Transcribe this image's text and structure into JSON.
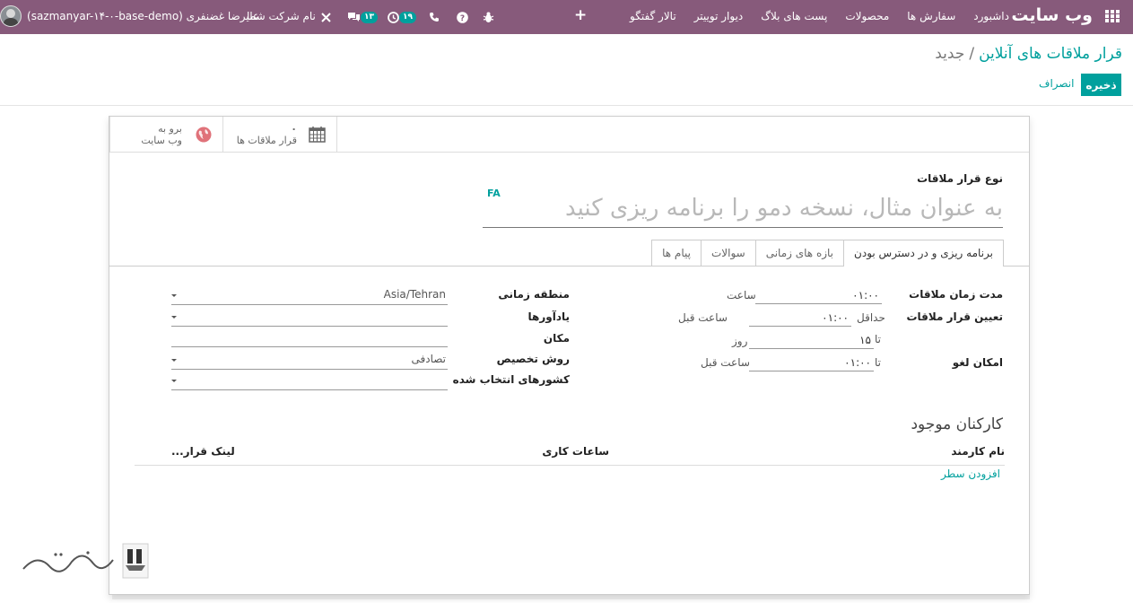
{
  "navbar": {
    "brand": "وب سایت",
    "menu": [
      "داشبورد",
      "سفارش ها",
      "محصولات",
      "پست های بلاگ",
      "دیوار توییتر",
      "تالار گفتگو"
    ],
    "plus": "+",
    "activity_count": "۱۹",
    "messages_count": "۱۳",
    "company": "نام شرکت شما",
    "user_name": "علیرضا غضنفری (sazmanyar-۱۴-۰-base-demo)"
  },
  "breadcrumb": {
    "parent": "قرار ملاقات های آنلاین",
    "separator": "/",
    "current": "جدید"
  },
  "buttons": {
    "save": "ذخیره",
    "discard": "انصراف"
  },
  "smart_buttons": {
    "appointments_count": "۰",
    "appointments_label": "قرار ملاقات ها",
    "website_line1": "برو به",
    "website_line2": "وب سایت"
  },
  "form": {
    "name_label": "نوع قرار ملاقات",
    "name_placeholder": "به عنوان مثال، نسخه دمو را برنامه ریزی کنید",
    "lang_tag": "FA"
  },
  "tabs": [
    {
      "label": "برنامه ریزی و در دسترس بودن",
      "active": true
    },
    {
      "label": "بازه های زمانی",
      "active": false
    },
    {
      "label": "سوالات",
      "active": false
    },
    {
      "label": "پیام ها",
      "active": false
    }
  ],
  "left_group": {
    "duration_label": "مدت زمان ملاقات",
    "duration_value": "۰۱:۰۰",
    "duration_unit": "ساعت",
    "scheduling_label": "تعیین قرار ملاقات",
    "min_prefix": "حداقل",
    "min_value": "۰۱:۰۰",
    "min_unit": "ساعت قبل",
    "max_prefix": "تا",
    "max_value": "۱۵",
    "max_unit": "روز",
    "cancel_label": "امکان لغو",
    "cancel_prefix": "تا",
    "cancel_value": "۰۱:۰۰",
    "cancel_unit": "ساعت قبل"
  },
  "right_group": {
    "timezone_label": "منطقه زمانی",
    "timezone_value": "Asia/Tehran",
    "reminders_label": "یادآورها",
    "location_label": "مکان",
    "assign_method_label": "روش تخصیص",
    "assign_method_value": "تصادفی",
    "countries_label": "کشورهای انتخاب شده"
  },
  "employees": {
    "title": "کارکنان موجود",
    "col_name": "نام کارمند",
    "col_hours": "ساعات کاری",
    "col_link": "لینک قرار...",
    "add_line": "افزودن سطر"
  },
  "colors": {
    "navbar": "#875a7b",
    "primary": "#00a09d"
  }
}
